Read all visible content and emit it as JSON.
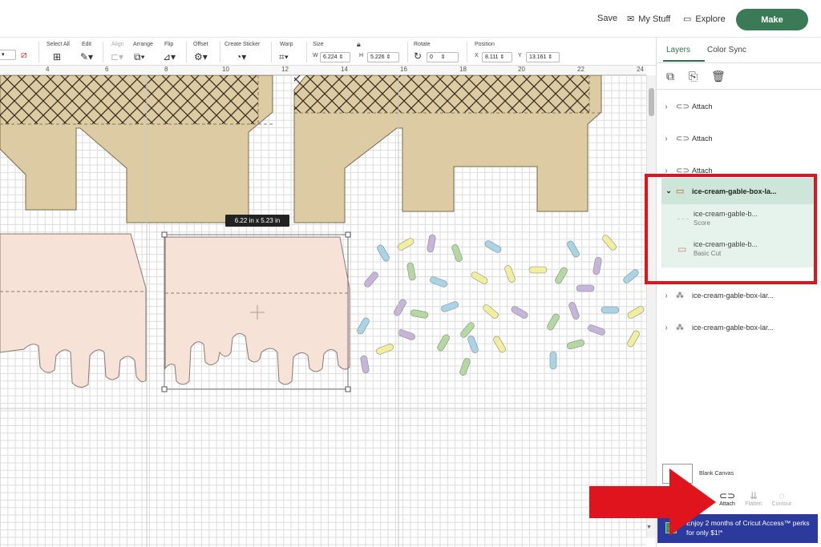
{
  "header": {
    "save_label": "Save",
    "mystuff_label": "My Stuff",
    "explore_label": "Explore",
    "make_label": "Make"
  },
  "toolbar": {
    "select_all": "Select All",
    "edit": "Edit",
    "align": "Align",
    "arrange": "Arrange",
    "flip": "Flip",
    "offset": "Offset",
    "create_sticker": "Create Sticker",
    "warp": "Warp",
    "size": "Size",
    "w_label": "W",
    "w_value": "6.224",
    "h_label": "H",
    "h_value": "5.226",
    "rotate": "Rotate",
    "rotate_value": "0",
    "position": "Position",
    "x_label": "X",
    "x_value": "8.111",
    "y_label": "Y",
    "y_value": "13.161"
  },
  "ruler": {
    "ticks": [
      "4",
      "6",
      "8",
      "10",
      "12",
      "14",
      "16",
      "18",
      "20",
      "22",
      "24"
    ]
  },
  "canvas": {
    "size_tooltip": "6.22  in x 5.23  in",
    "colors": {
      "cone": "#dccba3",
      "cone_stroke": "#7a6a4a",
      "drip": "#f6e2d7",
      "drip_stroke": "#8a7a70",
      "sprinkle_blue": "#a8d4e6",
      "sprinkle_yellow": "#f1ee9c",
      "sprinkle_purple": "#c6b4db",
      "sprinkle_green": "#b3d9a0"
    }
  },
  "panel": {
    "tabs": [
      "Layers",
      "Color Sync"
    ],
    "layers": [
      {
        "label": "Attach",
        "icon": "attach-icon"
      },
      {
        "label": "Attach",
        "icon": "attach-icon"
      },
      {
        "label": "Attach",
        "icon": "attach-icon"
      }
    ],
    "selected_group": {
      "label": "ice-cream-gable-box-la...",
      "children": [
        {
          "name": "ice-cream-gable-b...",
          "type": "Score"
        },
        {
          "name": "ice-cream-gable-b...",
          "type": "Basic Cut"
        }
      ]
    },
    "more_layers": [
      {
        "label": "ice-cream-gable-box-lar..."
      },
      {
        "label": "ice-cream-gable-box-lar..."
      }
    ],
    "blank_canvas": "Blank Canvas",
    "bottom_tools": [
      "Attach",
      "Flatten",
      "Contour"
    ],
    "banner": "Enjoy 2 months of Cricut Access™ perks for only $1!*"
  }
}
